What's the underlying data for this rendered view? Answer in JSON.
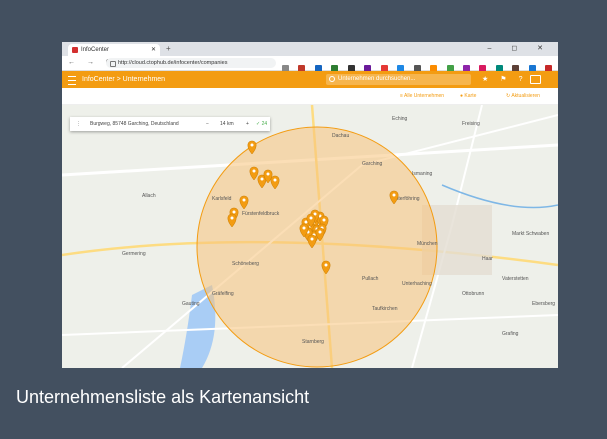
{
  "browser": {
    "tab_title": "InfoCenter",
    "new_tab": "+",
    "window_controls": "– ◻ ✕",
    "nav": "← → C",
    "url": "http://cloud.ctophub.de/infocenter/companies"
  },
  "app": {
    "breadcrumb": "InfoCenter > Unternehmen",
    "search_placeholder": "Unternehmen durchsuchen...",
    "toolbar": {
      "add_company": "Alle Unternehmen",
      "filter": "Karte",
      "refresh": "Aktualisieren"
    }
  },
  "map": {
    "controls": {
      "location": "Burgweg, 85748 Garching, Deutschland",
      "minus": "−",
      "radius": "14 km",
      "plus": "+",
      "count": "✓ 24"
    },
    "places": [
      "Dachau",
      "Allach",
      "Karlsfeld",
      "Fürstenfeldbruck",
      "Schöneberg",
      "Germering",
      "Gräfelfing",
      "München",
      "Starnberg",
      "Unterföhring",
      "Ismaning",
      "Garching",
      "Haar",
      "Vaterstetten",
      "Gauting",
      "Pullach",
      "Eching",
      "Freising",
      "Taufkirchen",
      "Ottobrunn",
      "Unterhaching",
      "Markt Schwaben",
      "Grafing",
      "Ebersberg"
    ],
    "pin_count": 24,
    "accent": "#f39c12",
    "circle_color": "#f7c27a"
  },
  "caption": "Unternehmensliste als Kartenansicht"
}
